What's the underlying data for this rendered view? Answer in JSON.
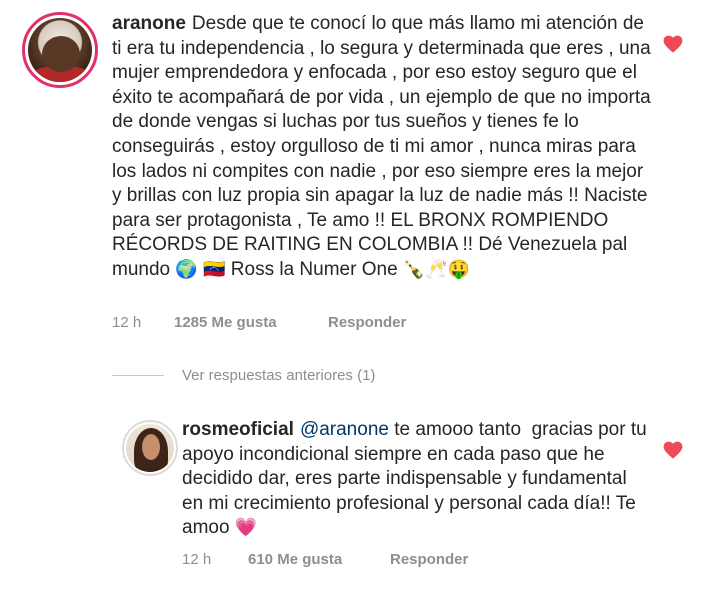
{
  "comment": {
    "username": "aranone",
    "text": "Desde que te conocí lo que más llamo mi atención de ti era tu independencia , lo segura y determinada que eres , una mujer emprendedora y enfocada , por eso estoy seguro que el éxito te acompañará de por vida , un ejemplo de que no importa de donde vengas si luchas por tus sueños y tienes fe lo conseguirás , estoy orgulloso de ti mi amor , nunca miras para los lados ni compites con nadie , por eso siempre eres la mejor y brillas con luz propia sin apagar la luz de nadie más !! Naciste para ser protagonista , Te amo !! EL BRONX ROMPIENDO RÉCORDS DE RAITING EN COLOMBIA !! Dé Venezuela pal mundo",
    "emoji_globe": "🌍",
    "emoji_flag": "🇻🇪",
    "tail_text": "Ross la Numer One",
    "emoji_tail": "🍾🥂🤑",
    "time": "12 h",
    "likes": "1285 Me gusta",
    "reply_label": "Responder",
    "liked": true,
    "heart_color": "#ed4956"
  },
  "view_previous": "Ver respuestas anteriores (1)",
  "reply": {
    "username": "rosmeoficial",
    "mention": "@aranone",
    "text": "te amooo tanto ⁣ gracias por tu apoyo incondicional siempre en cada paso que he decidido dar, eres parte indispensable y fundamental en mi crecimiento profesional y personal cada día!! Te amoo",
    "emoji_heart": "💗",
    "time": "12 h",
    "likes": "610 Me gusta",
    "reply_label": "Responder",
    "liked": true,
    "heart_color": "#ed4956"
  },
  "icons": {
    "heart": "heart-icon"
  }
}
